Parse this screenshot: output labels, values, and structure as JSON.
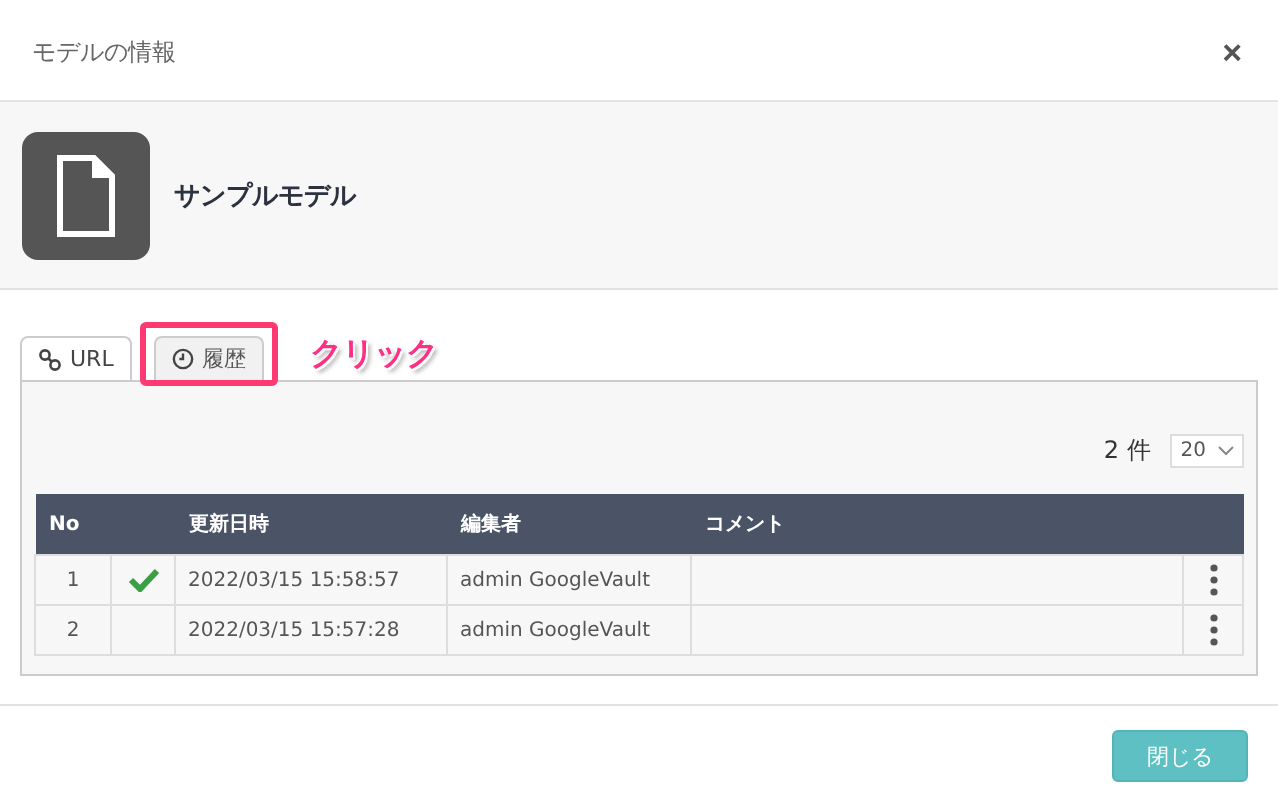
{
  "dialog": {
    "title": "モデルの情報",
    "close": "×"
  },
  "model": {
    "name": "サンプルモデル"
  },
  "tabs": [
    {
      "label": "URL",
      "kind": "link",
      "selected": true
    },
    {
      "label": "履歴",
      "kind": "clock",
      "selected": false
    }
  ],
  "annotation": {
    "text": "クリック"
  },
  "history": {
    "count": "2",
    "count_unit": "件",
    "page_size": "20",
    "columns": [
      "No",
      "",
      "更新日時",
      "編集者",
      "コメント",
      ""
    ],
    "rows": [
      {
        "no": "1",
        "current": true,
        "updated": "2022/03/15 15:58:57",
        "editor": "admin GoogleVault",
        "comment": ""
      },
      {
        "no": "2",
        "current": false,
        "updated": "2022/03/15 15:57:28",
        "editor": "admin GoogleVault",
        "comment": ""
      }
    ]
  },
  "buttons": [
    {
      "label": "閉じる"
    }
  ]
}
